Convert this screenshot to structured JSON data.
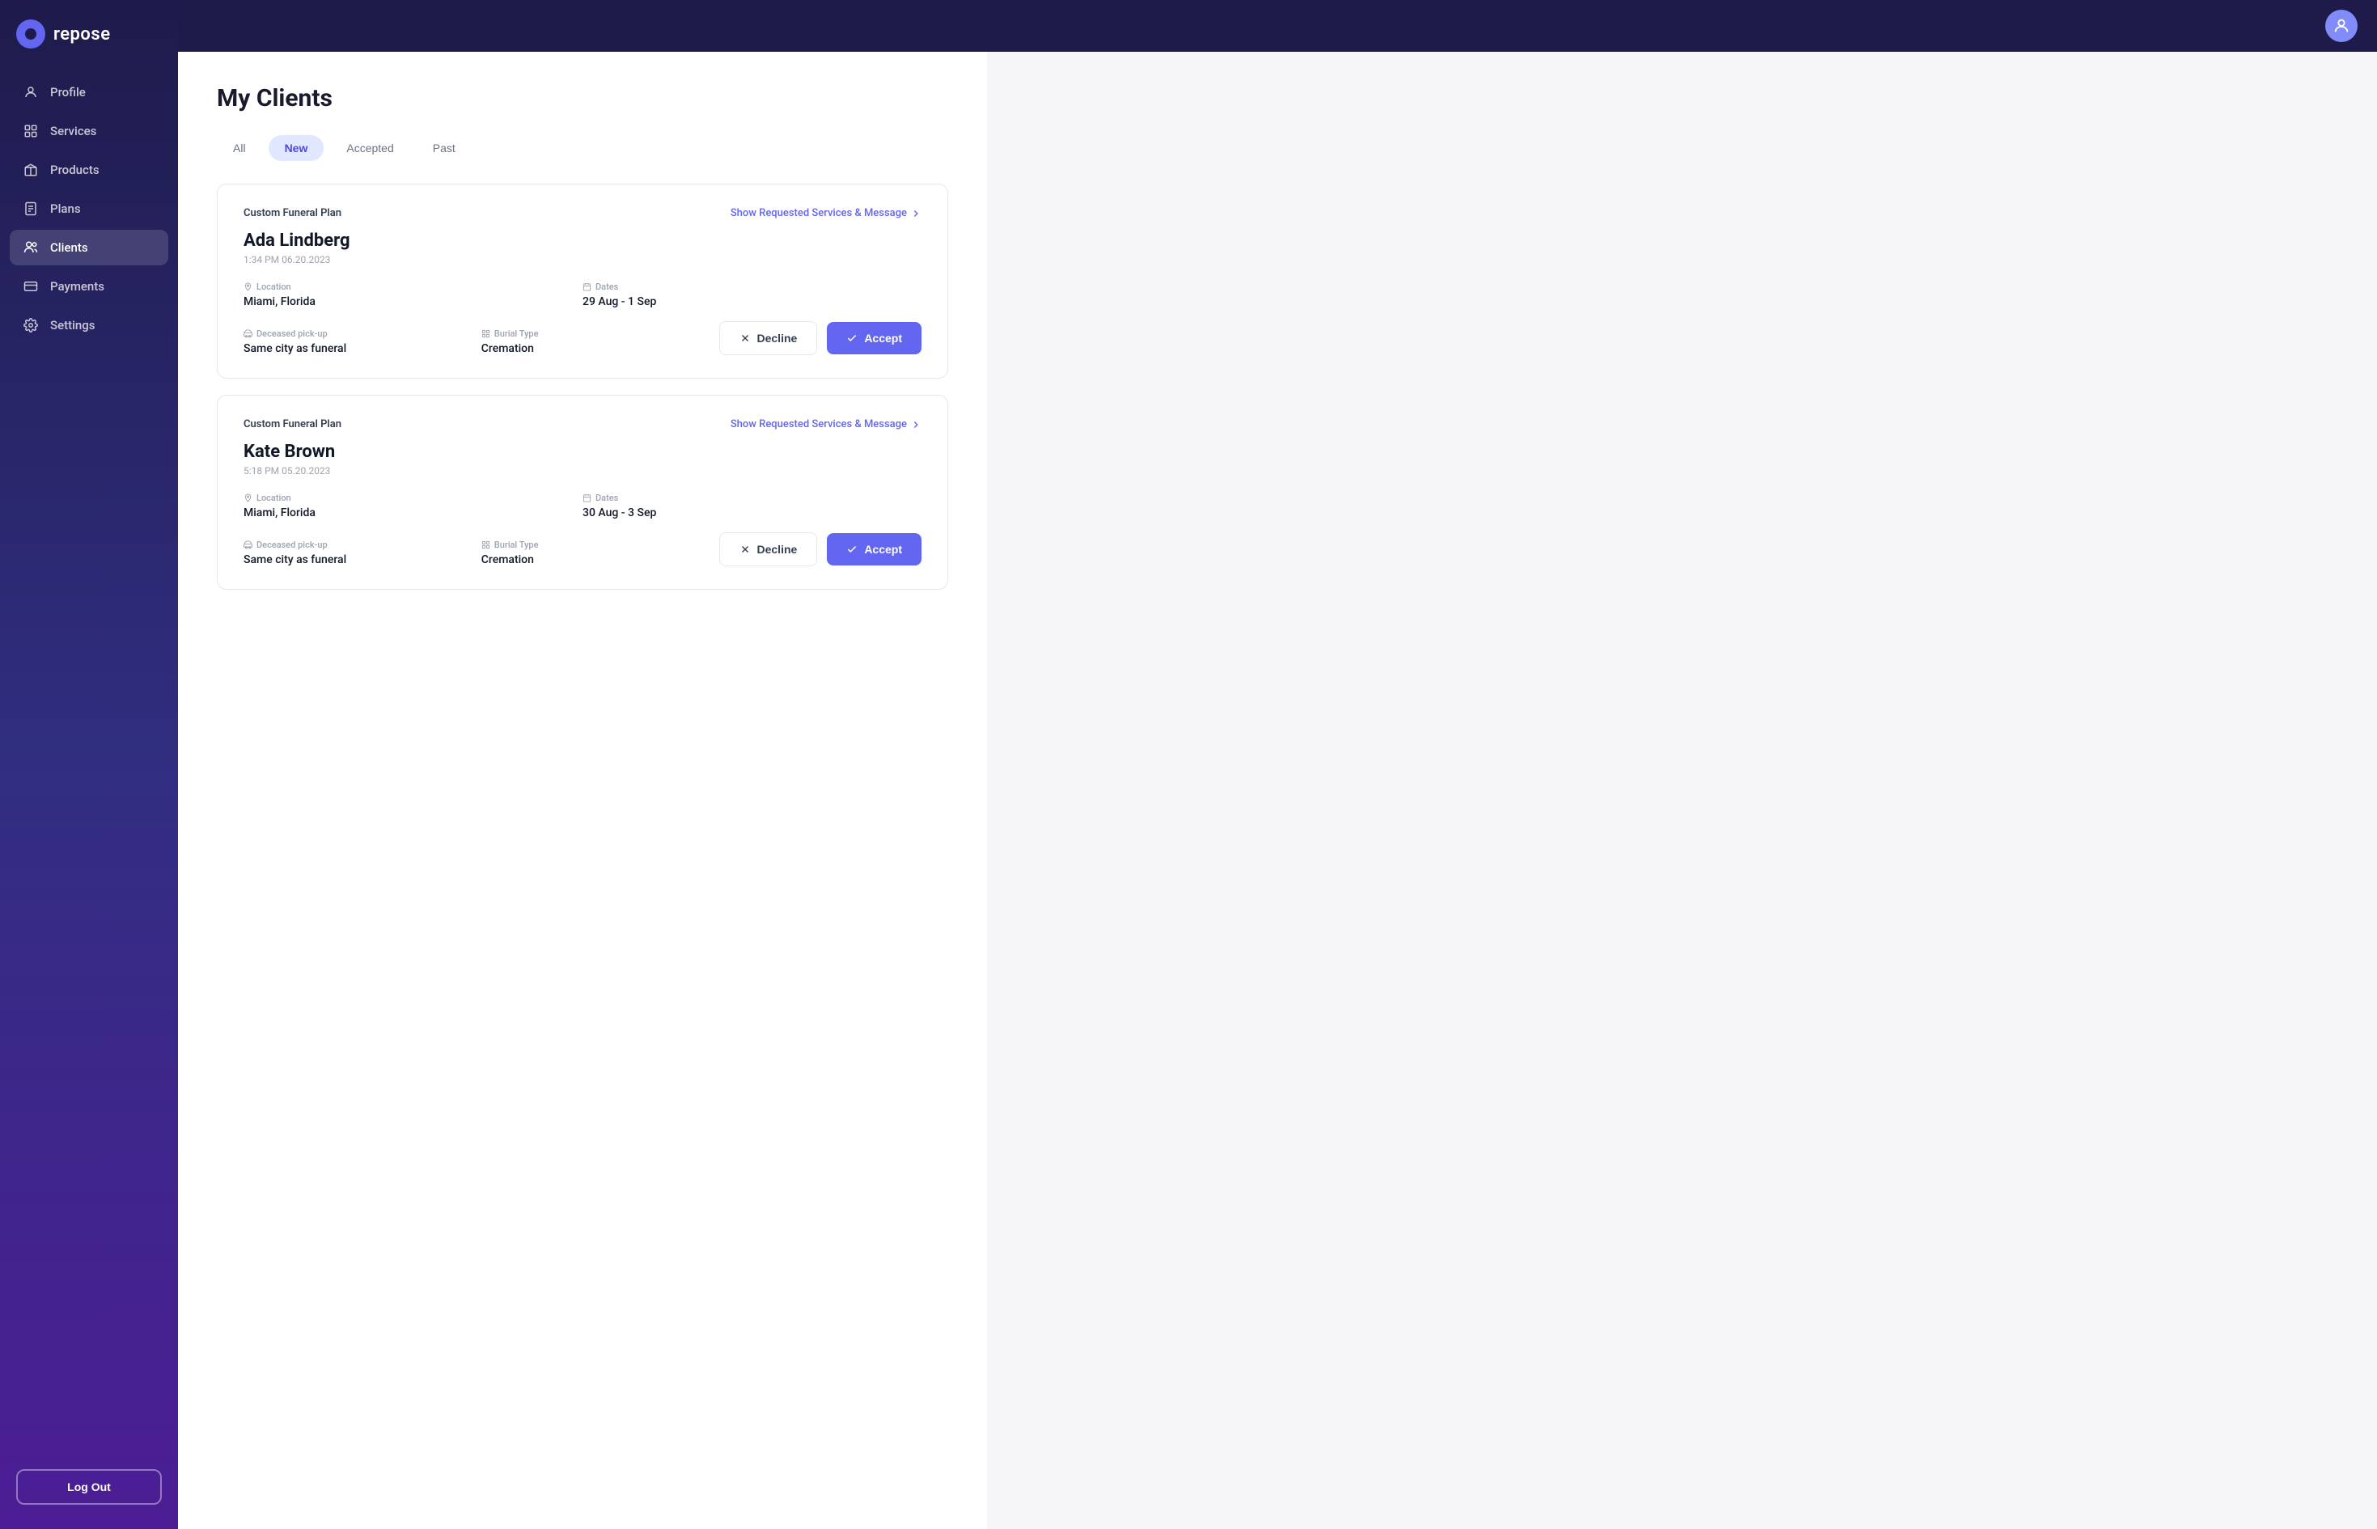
{
  "app": {
    "name": "repose"
  },
  "sidebar": {
    "nav_items": [
      {
        "id": "profile",
        "label": "Profile",
        "icon": "user-icon",
        "active": false
      },
      {
        "id": "services",
        "label": "Services",
        "icon": "grid-icon",
        "active": false
      },
      {
        "id": "products",
        "label": "Products",
        "icon": "box-icon",
        "active": false
      },
      {
        "id": "plans",
        "label": "Plans",
        "icon": "doc-icon",
        "active": false
      },
      {
        "id": "clients",
        "label": "Clients",
        "icon": "clients-icon",
        "active": true
      },
      {
        "id": "payments",
        "label": "Payments",
        "icon": "payment-icon",
        "active": false
      },
      {
        "id": "settings",
        "label": "Settings",
        "icon": "settings-icon",
        "active": false
      }
    ],
    "logout_label": "Log Out"
  },
  "page": {
    "title": "My Clients",
    "tabs": [
      {
        "id": "all",
        "label": "All",
        "active": false
      },
      {
        "id": "new",
        "label": "New",
        "active": true
      },
      {
        "id": "accepted",
        "label": "Accepted",
        "active": false
      },
      {
        "id": "past",
        "label": "Past",
        "active": false
      }
    ]
  },
  "clients": [
    {
      "id": 1,
      "plan": "Custom Funeral Plan",
      "show_services_label": "Show Requested Services & Message",
      "name": "Ada Lindberg",
      "timestamp": "1:34 PM 06.20.2023",
      "location_label": "Location",
      "location": "Miami, Florida",
      "dates_label": "Dates",
      "dates": "29 Aug - 1 Sep",
      "pickup_label": "Deceased pick-up",
      "pickup": "Same city as funeral",
      "burial_label": "Burial Type",
      "burial": "Cremation"
    },
    {
      "id": 2,
      "plan": "Custom Funeral Plan",
      "show_services_label": "Show Requested Services & Message",
      "name": "Kate Brown",
      "timestamp": "5:18 PM 05.20.2023",
      "location_label": "Location",
      "location": "Miami, Florida",
      "dates_label": "Dates",
      "dates": "30 Aug - 3 Sep",
      "pickup_label": "Deceased pick-up",
      "pickup": "Same city as funeral",
      "burial_label": "Burial Type",
      "burial": "Cremation"
    }
  ],
  "actions": {
    "decline": "Decline",
    "accept": "Accept"
  }
}
